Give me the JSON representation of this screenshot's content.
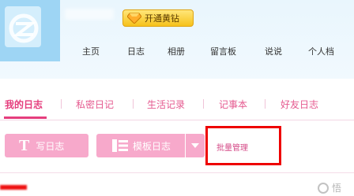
{
  "header": {
    "vip_button_label": "开通黄钻"
  },
  "nav": {
    "items": [
      "主页",
      "日志",
      "相册",
      "留言板",
      "说说",
      "个人档"
    ]
  },
  "blog_tabs": {
    "items": [
      "我的日志",
      "私密日记",
      "生活记录",
      "记事本",
      "好友日志"
    ],
    "active": "我的日志"
  },
  "toolbar": {
    "write_label": "写日志",
    "write_icon_letter": "T",
    "template_label": "模板日志",
    "bulk_manage_label": "批量管理"
  },
  "watermark": {
    "text": "悟"
  },
  "colors": {
    "accent_pink": "#e53e7d",
    "button_pink": "#f7a9cb",
    "highlight_red": "#ee0000",
    "header_blue": "#e9f6fd"
  }
}
